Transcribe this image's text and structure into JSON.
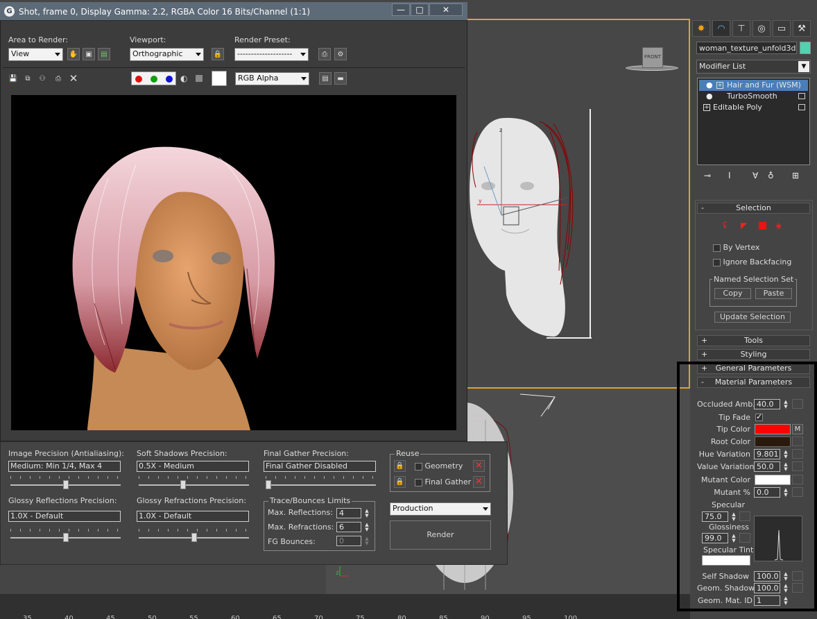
{
  "render_window": {
    "title": "Shot, frame 0, Display Gamma: 2.2, RGBA Color 16 Bits/Channel (1:1)",
    "title_controls": [
      "—",
      "□",
      "✕"
    ],
    "area_to_render_label": "Area to Render:",
    "area_to_render_value": "View",
    "viewport_label": "Viewport:",
    "viewport_value": "Orthographic",
    "render_preset_label": "Render Preset:",
    "render_preset_value": "--------------------",
    "channel_value": "RGB Alpha",
    "colors": {
      "red_dot": "#e01010",
      "green_dot": "#10a010",
      "blue_dot": "#1010e0"
    }
  },
  "mental_ray": {
    "image_precision_label": "Image Precision (Antialiasing):",
    "image_precision_value": "Medium: Min 1/4, Max 4",
    "soft_shadows_label": "Soft Shadows Precision:",
    "soft_shadows_value": "0.5X - Medium",
    "final_gather_label": "Final Gather Precision:",
    "final_gather_value": "Final Gather Disabled",
    "glossy_reflections_label": "Glossy Reflections Precision:",
    "glossy_reflections_value": "1.0X - Default",
    "glossy_refractions_label": "Glossy Refractions Precision:",
    "glossy_refractions_value": "1.0X - Default",
    "reuse_label": "Reuse",
    "geometry_label": "Geometry",
    "final_gather_reuse_label": "Final Gather",
    "trace_label": "Trace/Bounces Limits",
    "max_reflections_label": "Max. Reflections:",
    "max_reflections_value": "4",
    "max_refractions_label": "Max. Refractions:",
    "max_refractions_value": "6",
    "fg_bounces_label": "FG Bounces:",
    "fg_bounces_value": "0",
    "mode_value": "Production",
    "render_button": "Render",
    "slider_levels": {
      "image_precision": 0.5,
      "soft_shadows": 0.4,
      "final_gather": 0.0,
      "glossy_reflections": 0.5,
      "glossy_refractions": 0.5
    }
  },
  "viewport": {
    "viewcube_label": "FRONT"
  },
  "ruler_labels": [
    "35",
    "40",
    "45",
    "50",
    "55",
    "60",
    "65",
    "70",
    "75",
    "80",
    "85",
    "90",
    "95",
    "100"
  ],
  "command_panel": {
    "object_name": "woman_texture_unfold3d",
    "object_color": "#4fd3b0",
    "modifier_list_label": "Modifier List",
    "stack": [
      {
        "label": "Hair and Fur (WSM)",
        "selected": true
      },
      {
        "label": "TurboSmooth",
        "selected": false
      },
      {
        "label": "Editable Poly",
        "selected": false
      }
    ],
    "selection_rollout": "Selection",
    "by_vertex": "By Vertex",
    "ignore_backfacing": "Ignore Backfacing",
    "named_selection_set": "Named Selection Set",
    "copy_button": "Copy",
    "paste_button": "Paste",
    "update_selection_button": "Update Selection",
    "tools_rollout": "Tools",
    "styling_rollout": "Styling",
    "general_parameters_rollout": "General Parameters",
    "material_parameters_rollout": "Material Parameters",
    "occluded_amb_label": "Occluded Amb.",
    "occluded_amb_value": "40.0",
    "tip_fade_label": "Tip Fade",
    "tip_color_label": "Tip Color",
    "tip_color": "#ff0000",
    "root_color_label": "Root Color",
    "root_color": "#2a1a0e",
    "hue_variation_label": "Hue Variation",
    "hue_variation_value": "9.801",
    "value_variation_label": "Value Variation",
    "value_variation_value": "50.0",
    "mutant_color_label": "Mutant Color",
    "mutant_color": "#ffffff",
    "mutant_pct_label": "Mutant %",
    "mutant_pct_value": "0.0",
    "specular_label": "Specular",
    "specular_value": "75.0",
    "glossiness_label": "Glossiness",
    "glossiness_value": "99.0",
    "specular_tint_label": "Specular Tint",
    "self_shadow_label": "Self Shadow",
    "self_shadow_value": "100.0",
    "geom_shadow_label": "Geom. Shadow",
    "geom_shadow_value": "100.0",
    "geom_mat_id_label": "Geom. Mat. ID",
    "geom_mat_id_value": "1",
    "m_button": "M"
  }
}
